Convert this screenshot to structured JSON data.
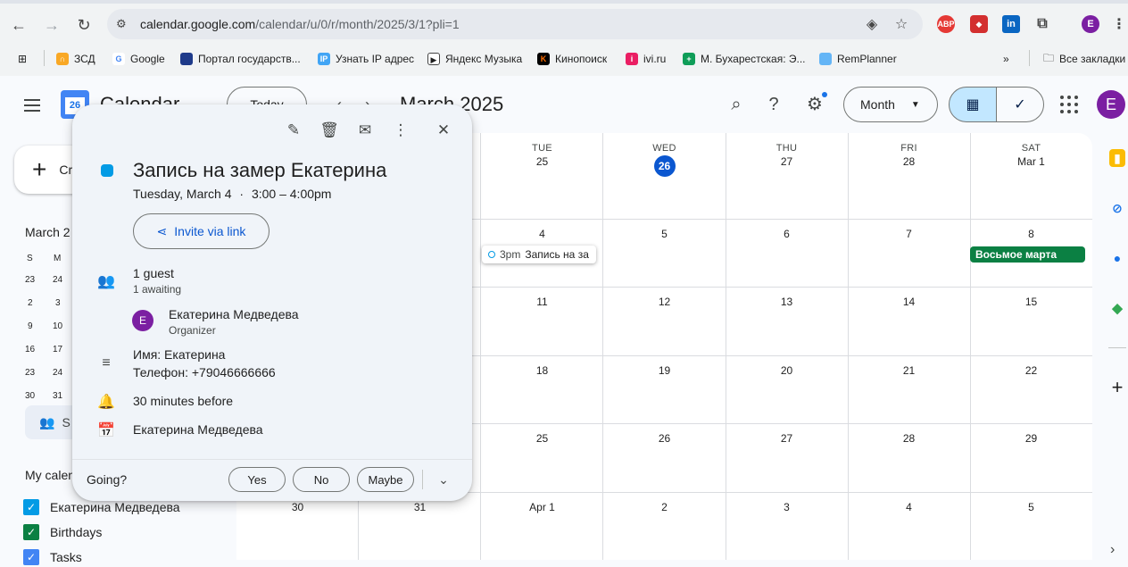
{
  "browser": {
    "url_host": "calendar.google.com",
    "url_path": "/calendar/u/0/r/month/2025/3/1?pli=1",
    "bookmarks": [
      "ЗСД",
      "Google",
      "Портал государств...",
      "Узнать IP адрес",
      "Яндекс Музыка",
      "Кинопоиск",
      "ivi.ru",
      "М. Бухарестская: Э...",
      "RemPlanner"
    ],
    "all_bookmarks": "Все закладки",
    "profile_initial": "E",
    "more_bookmarks": "»"
  },
  "header": {
    "app_title": "Calendar",
    "logo_day": "26",
    "today_label": "Today",
    "month_title": "March 2025",
    "view_label": "Month",
    "avatar_initial": "E"
  },
  "sidebar": {
    "create_label": "Cr",
    "mini_month_title": "March 2",
    "mini_dow": [
      "S",
      "M"
    ],
    "mini_rows": [
      [
        "23",
        "24"
      ],
      [
        "2",
        "3"
      ],
      [
        "9",
        "10"
      ],
      [
        "16",
        "17"
      ],
      [
        "23",
        "24"
      ],
      [
        "30",
        "31"
      ]
    ],
    "search_people_label": "S",
    "my_calendars_title": "My calen",
    "calendars": [
      {
        "label": "Екатерина Медведева",
        "color": "#039be5"
      },
      {
        "label": "Birthdays",
        "color": "#0b8043"
      },
      {
        "label": "Tasks",
        "color": "#4285f4"
      }
    ]
  },
  "grid": {
    "header_cells": [
      {
        "dow": "TUE",
        "num": "25"
      },
      {
        "dow": "WED",
        "num": "26",
        "today": true
      },
      {
        "dow": "THU",
        "num": "27"
      },
      {
        "dow": "FRI",
        "num": "28"
      },
      {
        "dow": "SAT",
        "num": "Mar 1"
      }
    ],
    "weeks": [
      [
        "4",
        "5",
        "6",
        "7",
        "8"
      ],
      [
        "11",
        "12",
        "13",
        "14",
        "15"
      ],
      [
        "18",
        "19",
        "20",
        "21",
        "22"
      ],
      [
        "25",
        "26",
        "27",
        "28",
        "29"
      ],
      [
        "Apr 1",
        "2",
        "3",
        "4",
        "5"
      ]
    ],
    "last_week_partial": [
      "30",
      "31"
    ],
    "event_chip": {
      "time": "3pm",
      "name": "Запись на за"
    },
    "allday_chip": "Восьмое марта",
    "today_color": "#0b57d0"
  },
  "popup": {
    "title": "Запись на замер Екатерина",
    "date": "Tuesday, March 4",
    "separator": "·",
    "time": "3:00 – 4:00pm",
    "invite_label": "Invite via link",
    "guest_count": "1 guest",
    "guest_status": "1 awaiting",
    "guest_name": "Екатерина Медведева",
    "guest_role": "Organizer",
    "guest_initial": "E",
    "description_line1": "Имя: Екатерина",
    "description_line2": "Телефон: +79046666666",
    "reminder": "30 minutes before",
    "calendar_owner": "Екатерина Медведева",
    "going_label": "Going?",
    "rsvp": {
      "yes": "Yes",
      "no": "No",
      "maybe": "Maybe"
    },
    "event_color": "#039be5"
  }
}
